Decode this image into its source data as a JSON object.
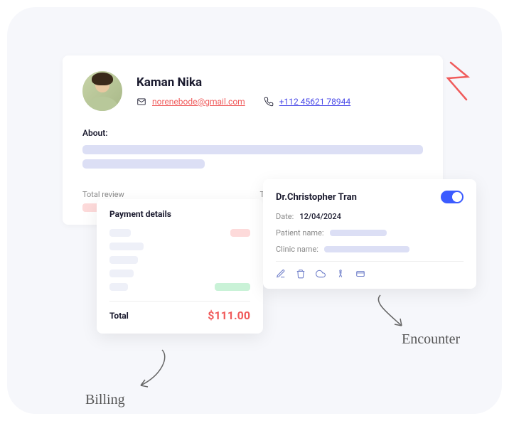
{
  "profile": {
    "name": "Kaman Nika",
    "email": "norenebode@gmail.com",
    "phone": "+112 45621 78944",
    "about_label": "About:",
    "stats": {
      "review_label": "Total review",
      "appointments_label": "Total appointments"
    }
  },
  "payment": {
    "title": "Payment details",
    "total_label": "Total",
    "total_amount": "$111.00"
  },
  "encounter": {
    "title": "Dr.Christopher Tran",
    "date_label": "Date:",
    "date_value": "12/04/2024",
    "patient_label": "Patient name:",
    "clinic_label": "Clinic name:"
  },
  "annotations": {
    "billing": "Billing",
    "encounter": "Encounter"
  }
}
